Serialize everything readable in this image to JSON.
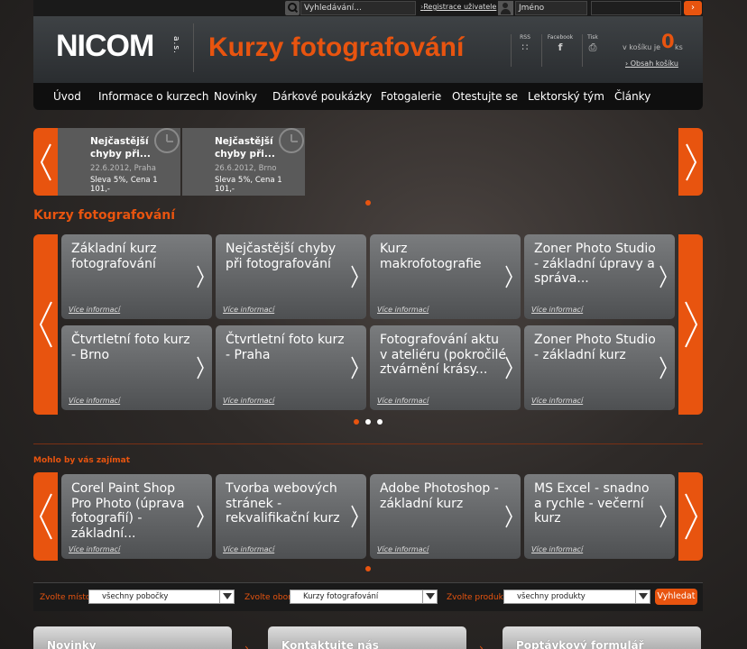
{
  "topbar": {
    "search_placeholder": "Vyhledávání...",
    "register_link": "Registrace uživatele",
    "name_placeholder": "Jméno",
    "login_arrow": "›"
  },
  "header": {
    "logo_text": "NICOM",
    "logo_suffix": "a.s.",
    "site_title": "Kurzy fotografování",
    "social": [
      {
        "label": "RSS",
        "icon": "rss-icon",
        "glyph": "∷"
      },
      {
        "label": "Facebook",
        "icon": "facebook-icon",
        "glyph": "f"
      },
      {
        "label": "Tisk",
        "icon": "print-icon",
        "glyph": "⎙"
      }
    ],
    "cart_prefix": "v košíku je",
    "cart_count": "0",
    "cart_unit": "ks",
    "cart_link": "Obsah košíku"
  },
  "nav": {
    "items": [
      "Úvod",
      "Informace o kurzech",
      "Novinky",
      "Dárkové poukázky",
      "Fotogalerie",
      "Otestujte se",
      "Lektorský tým",
      "Články"
    ]
  },
  "top_carousel": {
    "items": [
      {
        "title": "Nejčastější chyby při...",
        "date": "22.6.2012, Praha",
        "price": "Sleva 5%, Cena 1 101,-"
      },
      {
        "title": "Nejčastější chyby při...",
        "date": "26.6.2012, Brno",
        "price": "Sleva 5%, Cena 1 101,-"
      }
    ]
  },
  "courses": {
    "title": "Kurzy fotografování",
    "more_label": "Více informací",
    "cards": [
      "Základní kurz fotografování",
      "Nejčastější chyby při fotografování",
      "Kurz makrofotografie",
      "Zoner Photo Studio - základní úpravy a správa...",
      "Čtvrtletní foto kurz - Brno",
      "Čtvrtletní foto kurz - Praha",
      "Fotografování aktu v ateliéru (pokročilé ztvárnění krásy...",
      "Zoner Photo Studio - základní kurz"
    ]
  },
  "interest": {
    "title": "Mohlo by vás zajímat",
    "more_label": "Více informací",
    "cards": [
      "Corel Paint Shop Pro Photo (úprava fotografií) - základní...",
      "Tvorba webových stránek - rekvalifikační kurz",
      "Adobe Photoshop - základní kurz",
      "MS Excel - snadno a rychle - večerní kurz"
    ]
  },
  "filter": {
    "place_label": "Zvolte místo",
    "place_value": "všechny pobočky",
    "field_label": "Zvolte obor",
    "field_value": "Kurzy fotografování",
    "product_label": "Zvolte produkt",
    "product_value": "všechny produkty",
    "search_button": "Vyhledat"
  },
  "bottom_boxes": [
    "Novinky",
    "Kontaktujte nás",
    "Poptávkový formulář"
  ],
  "colors": {
    "accent": "#e8540f",
    "nav_bg": "#0f0f0f",
    "card_top": "#7a7c7e",
    "card_bottom": "#4e5052"
  }
}
